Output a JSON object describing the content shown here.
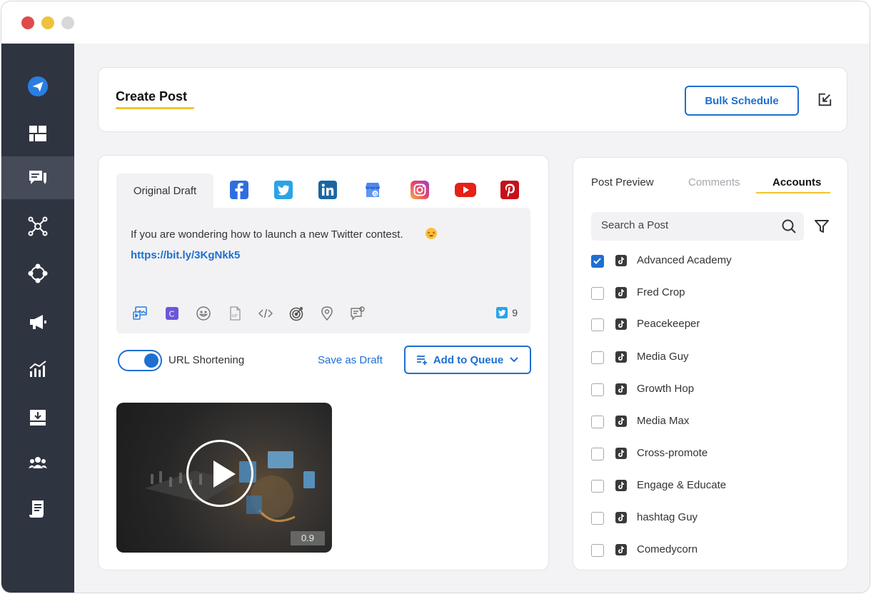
{
  "window": {
    "controls": [
      "close",
      "minimize",
      "maximize"
    ]
  },
  "sidebar": {
    "items": [
      {
        "icon": "send-logo-icon",
        "active": false
      },
      {
        "icon": "dashboard-icon",
        "active": false
      },
      {
        "icon": "compose-icon",
        "active": true
      },
      {
        "icon": "network-icon",
        "active": false
      },
      {
        "icon": "hub-icon",
        "active": false
      },
      {
        "icon": "megaphone-icon",
        "active": false
      },
      {
        "icon": "analytics-icon",
        "active": false
      },
      {
        "icon": "inbox-download-icon",
        "active": false
      },
      {
        "icon": "team-icon",
        "active": false
      },
      {
        "icon": "document-icon",
        "active": false
      }
    ]
  },
  "header": {
    "title": "Create Post",
    "bulk_schedule_label": "Bulk Schedule"
  },
  "composer": {
    "original_tab_label": "Original Draft",
    "networks": [
      "facebook",
      "twitter",
      "linkedin",
      "google-business",
      "instagram",
      "youtube",
      "pinterest"
    ],
    "text": "If you are wondering how to launch a new Twitter contest.",
    "link": "https://bit.ly/3KgNkk5",
    "twitter_count": "9",
    "url_shortening_label": "URL Shortening",
    "url_shortening_on": true,
    "save_draft_label": "Save as Draft",
    "add_queue_label": "Add to Queue",
    "video_duration": "0.9"
  },
  "right_panel": {
    "tabs": [
      "Post Preview",
      "Comments",
      "Accounts"
    ],
    "active_tab": "Accounts",
    "search_placeholder": "Search a Post",
    "accounts": [
      {
        "name": "Advanced Academy",
        "checked": true
      },
      {
        "name": "Fred Crop",
        "checked": false
      },
      {
        "name": "Peacekeeper",
        "checked": false
      },
      {
        "name": "Media Guy",
        "checked": false
      },
      {
        "name": "Growth Hop",
        "checked": false
      },
      {
        "name": "Media Max",
        "checked": false
      },
      {
        "name": "Cross-promote",
        "checked": false
      },
      {
        "name": "Engage & Educate",
        "checked": false
      },
      {
        "name": "hashtag Guy",
        "checked": false
      },
      {
        "name": "Comedycorn",
        "checked": false
      }
    ]
  },
  "colors": {
    "accent": "#1e6fd0",
    "sidebar_bg": "#2f3441",
    "highlight_underline": "#f2c52c"
  }
}
